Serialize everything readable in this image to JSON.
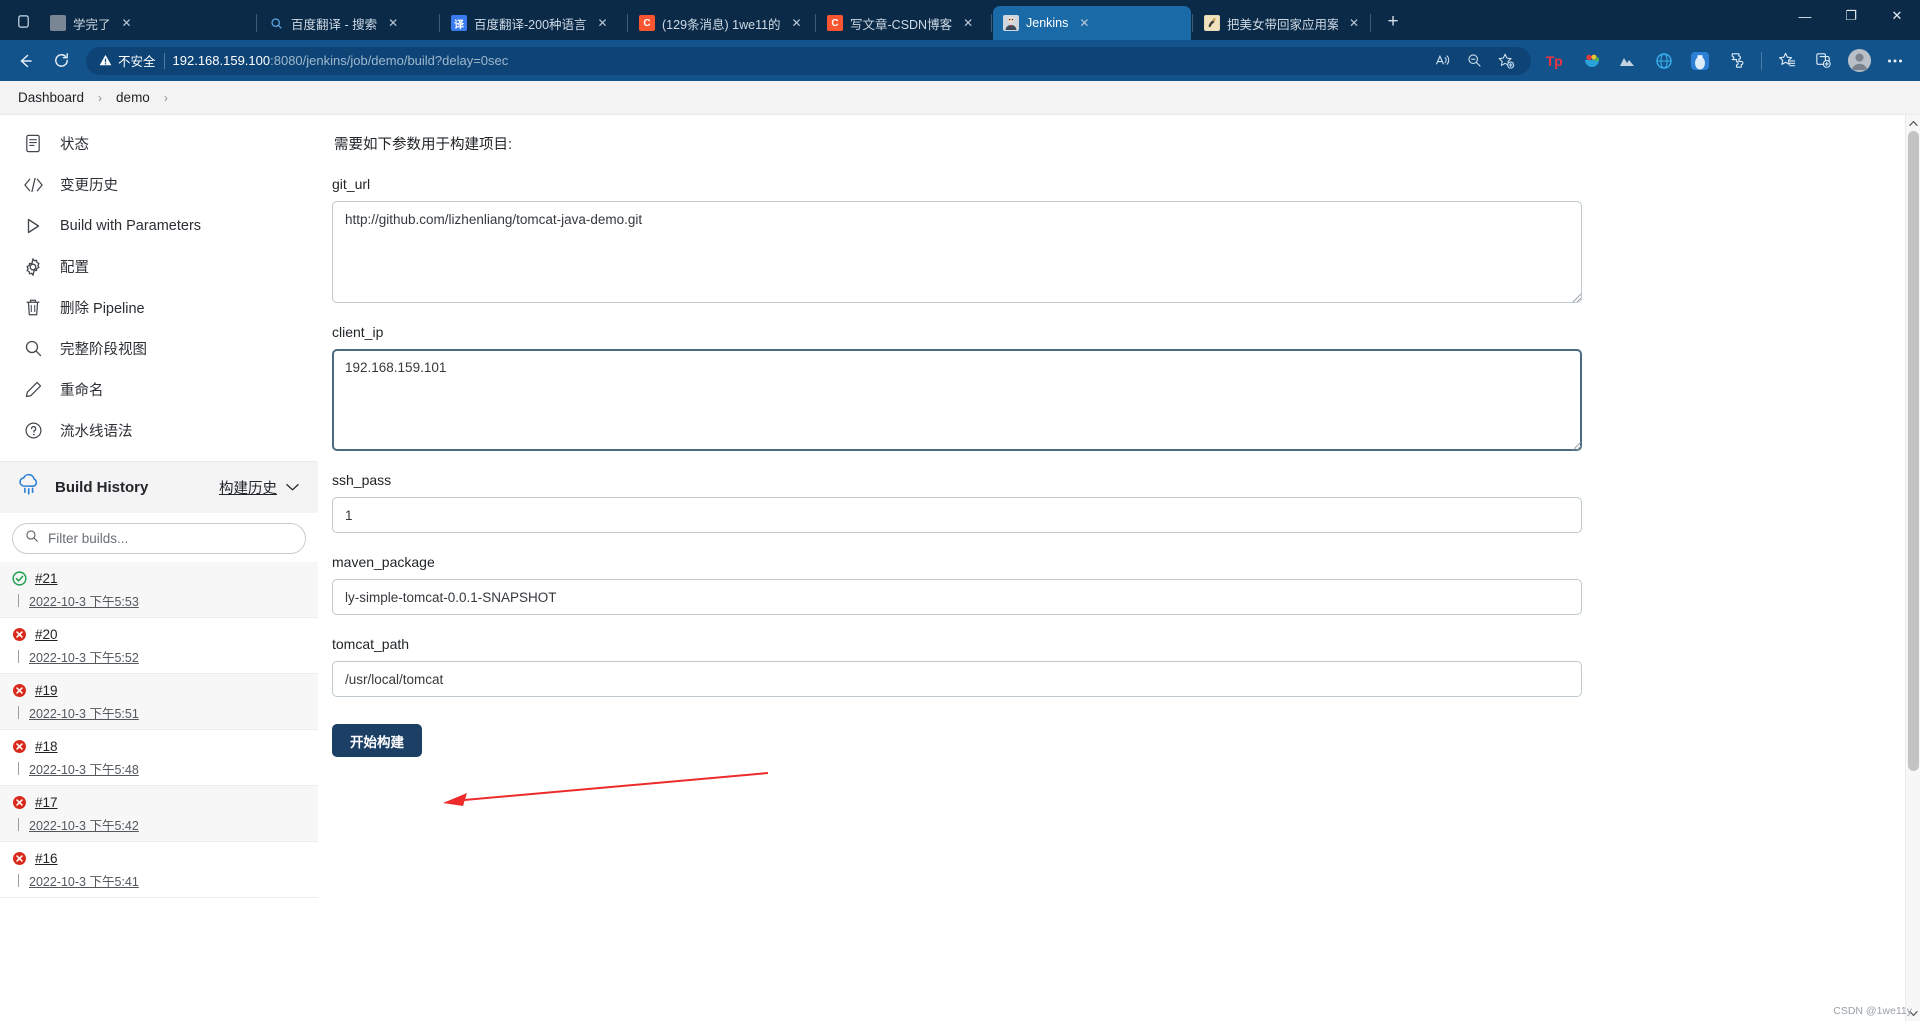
{
  "browser": {
    "tabs": [
      {
        "title": "学完了",
        "favicon": "page-icon",
        "favicon_color": "#7b8694",
        "favicon_text": "",
        "active": false
      },
      {
        "title": "百度翻译 - 搜索",
        "favicon": "search-icon",
        "favicon_color": "transparent",
        "favicon_text": "",
        "active": false
      },
      {
        "title": "百度翻译-200种语言",
        "favicon": "baidu-translate-icon",
        "favicon_color": "#3a7bf0",
        "favicon_text": "译",
        "active": false
      },
      {
        "title": "(129条消息) 1we11的",
        "favicon": "csdn-icon",
        "favicon_color": "#fc5531",
        "favicon_text": "C",
        "active": false
      },
      {
        "title": "写文章-CSDN博客",
        "favicon": "csdn-icon",
        "favicon_color": "#fc5531",
        "favicon_text": "C",
        "active": false
      },
      {
        "title": "Jenkins",
        "favicon": "jenkins-icon",
        "favicon_color": "#d9d3c8",
        "favicon_text": "",
        "active": true
      },
      {
        "title": "把美女带回家应用案",
        "favicon": "app-icon",
        "favicon_color": "#e8d9b0",
        "favicon_text": "",
        "active": false
      }
    ],
    "new_tab_label": "+",
    "window_controls": {
      "minimize": "—",
      "maximize": "❐",
      "close": "✕"
    },
    "nav": {
      "back": "←",
      "reload": "↻"
    },
    "omnibox": {
      "security_label": "不安全",
      "url_host": "192.168.159.100",
      "url_rest": ":8080/jenkins/job/demo/build?delay=0sec"
    },
    "toolbar_icons": [
      "read-aloud-icon",
      "zoom-out-icon",
      "add-favorite-icon",
      "tp-extension-icon",
      "fruit-extension-icon",
      "mountain-extension-icon",
      "globe-extension-icon",
      "penguin-extension-icon",
      "puzzle-extension-icon",
      "favorites-icon",
      "collections-icon",
      "profile-avatar",
      "settings-more-icon"
    ]
  },
  "breadcrumb": {
    "items": [
      "Dashboard",
      "demo"
    ],
    "separator": "›"
  },
  "sidebar": {
    "items": [
      {
        "label": "状态",
        "icon": "document-icon"
      },
      {
        "label": "变更历史",
        "icon": "code-icon"
      },
      {
        "label": "Build with Parameters",
        "icon": "play-icon"
      },
      {
        "label": "配置",
        "icon": "gear-icon"
      },
      {
        "label": "删除 Pipeline",
        "icon": "trash-icon"
      },
      {
        "label": "完整阶段视图",
        "icon": "search-icon"
      },
      {
        "label": "重命名",
        "icon": "pencil-icon"
      },
      {
        "label": "流水线语法",
        "icon": "help-icon"
      }
    ],
    "build_history": {
      "title": "Build History",
      "icon": "weather-cloud-icon",
      "link_label": "构建历史",
      "chevron": "⌄",
      "filter_placeholder": "Filter builds...",
      "filter_value": "",
      "filter_icon": "search-icon",
      "builds": [
        {
          "number": "#21",
          "time": "2022-10-3 下午5:53",
          "status": "success",
          "status_color": "#1a9e4b"
        },
        {
          "number": "#20",
          "time": "2022-10-3 下午5:52",
          "status": "failed",
          "status_color": "#d8291c"
        },
        {
          "number": "#19",
          "time": "2022-10-3 下午5:51",
          "status": "failed",
          "status_color": "#d8291c"
        },
        {
          "number": "#18",
          "time": "2022-10-3 下午5:48",
          "status": "failed",
          "status_color": "#d8291c"
        },
        {
          "number": "#17",
          "time": "2022-10-3 下午5:42",
          "status": "failed",
          "status_color": "#d8291c"
        },
        {
          "number": "#16",
          "time": "2022-10-3 下午5:41",
          "status": "failed",
          "status_color": "#d8291c"
        }
      ]
    }
  },
  "main": {
    "intro": "需要如下参数用于构建项目:",
    "fields": [
      {
        "label": "git_url",
        "value": "http://github.com/lizhenliang/tomcat-java-demo.git",
        "type": "textarea",
        "focused": false
      },
      {
        "label": "client_ip",
        "value": "192.168.159.101",
        "type": "textarea",
        "focused": true
      },
      {
        "label": "ssh_pass",
        "value": "1",
        "type": "input",
        "focused": false
      },
      {
        "label": "maven_package",
        "value": "ly-simple-tomcat-0.0.1-SNAPSHOT",
        "type": "input",
        "focused": false
      },
      {
        "label": "tomcat_path",
        "value": "/usr/local/tomcat",
        "type": "input",
        "focused": false
      }
    ],
    "submit_label": "开始构建",
    "submit_color": "#1c3f66",
    "annotation_arrow_color": "#ee2b2b"
  },
  "watermark": {
    "text": "CSDN @1we11y"
  }
}
